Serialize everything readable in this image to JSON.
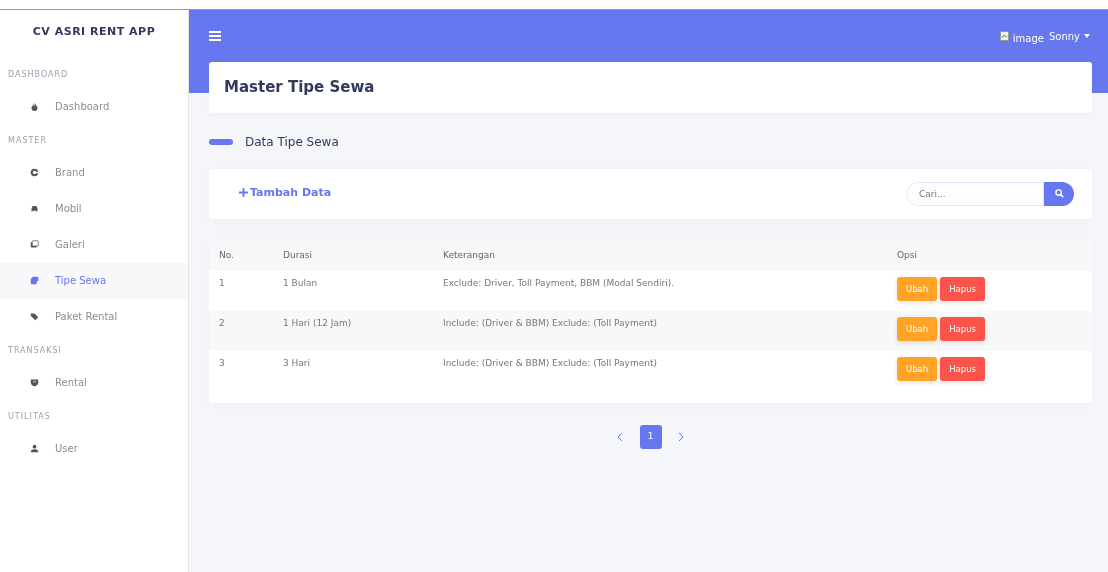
{
  "sidebar": {
    "brand": "CV ASRI RENT APP",
    "sections": [
      {
        "heading": "DASHBOARD",
        "items": [
          {
            "label": "Dashboard",
            "selected": false
          }
        ]
      },
      {
        "heading": "MASTER",
        "items": [
          {
            "label": "Brand",
            "selected": false
          },
          {
            "label": "Mobil",
            "selected": false
          },
          {
            "label": "Galeri",
            "selected": false
          },
          {
            "label": "Tipe Sewa",
            "selected": true
          },
          {
            "label": "Paket Rental",
            "selected": false
          }
        ]
      },
      {
        "heading": "TRANSAKSI",
        "items": [
          {
            "label": "Rental",
            "selected": false
          }
        ]
      },
      {
        "heading": "UTILITAS",
        "items": [
          {
            "label": "User",
            "selected": false
          }
        ]
      }
    ]
  },
  "topbar": {
    "avatar_alt": "image",
    "user": "Sonny"
  },
  "page_title": "Master Tipe Sewa",
  "section_title": "Data Tipe Sewa",
  "toolbar": {
    "add_button": "Tambah Data",
    "search_placeholder": "Cari..."
  },
  "table": {
    "columns": [
      "No.",
      "Durasi",
      "Keterangan",
      "Opsi"
    ],
    "rows": [
      {
        "no": "1",
        "durasi": "1 Bulan",
        "keterangan": "Exclude: Driver, Toll Payment, BBM (Modal Sendiri).",
        "actions": [
          "Ubah",
          "Hapus"
        ]
      },
      {
        "no": "2",
        "durasi": "1 Hari (12 Jam)",
        "keterangan": "Include: (Driver & BBM) Exclude: (Toll Payment)",
        "actions": [
          "Ubah",
          "Hapus"
        ]
      },
      {
        "no": "3",
        "durasi": "3 Hari",
        "keterangan": "Include: (Driver & BBM) Exclude: (Toll Payment)",
        "actions": [
          "Ubah",
          "Hapus"
        ]
      }
    ]
  },
  "pagination": {
    "pages": [
      {
        "label": "1",
        "selected": true
      }
    ]
  }
}
